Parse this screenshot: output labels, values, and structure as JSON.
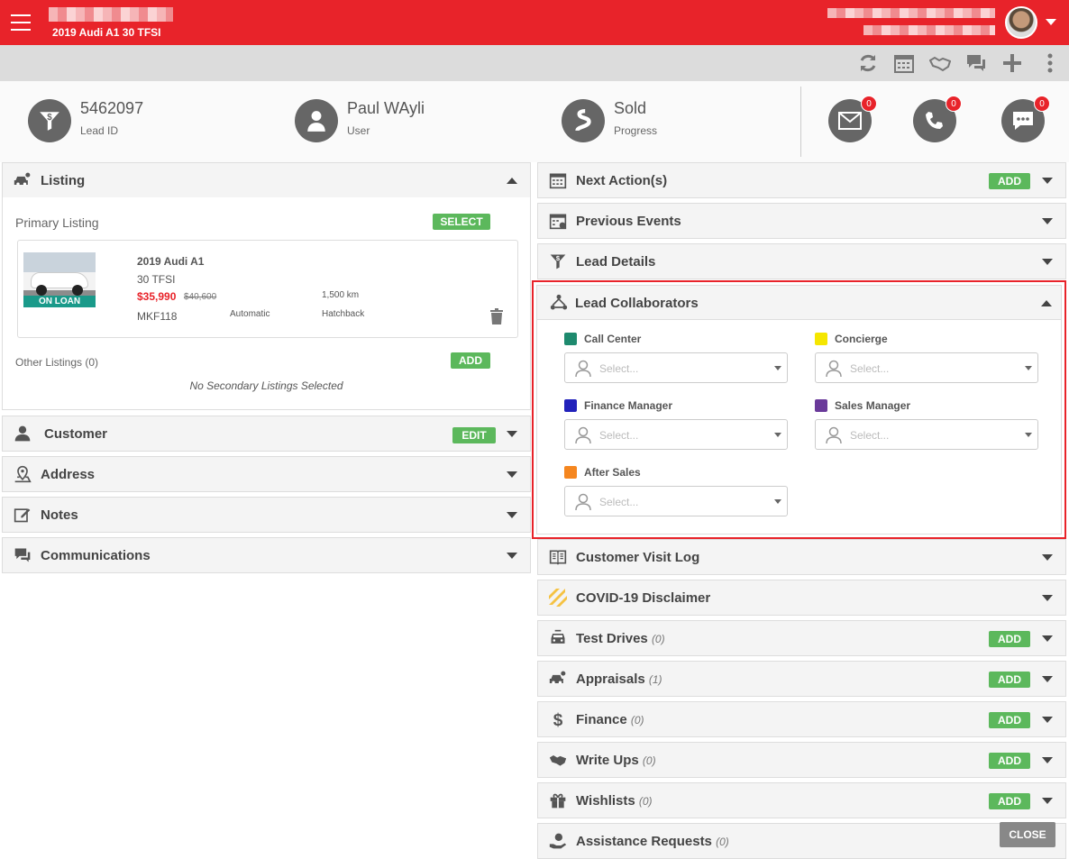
{
  "header": {
    "title": "2019 Audi A1 30 TFSI"
  },
  "stats": [
    {
      "value": "5462097",
      "label": "Lead ID"
    },
    {
      "value": "Paul WAyli",
      "label": "User"
    },
    {
      "value": "Sold",
      "label": "Progress"
    }
  ],
  "quick_actions": [
    {
      "icon": "envelope-icon",
      "count": "0"
    },
    {
      "icon": "phone-icon",
      "count": "0"
    },
    {
      "icon": "chat-icon",
      "count": "0"
    }
  ],
  "listing": {
    "title": "Listing",
    "primary_label": "Primary Listing",
    "select_label": "SELECT",
    "car": {
      "name": "2019 Audi A1",
      "variant": "30 TFSI",
      "price": "$35,990",
      "old_price": "$40,600",
      "km": "1,500 km",
      "rego": "MKF118",
      "transmission": "Automatic",
      "body": "Hatchback",
      "badge": "ON LOAN"
    },
    "other_label": "Other Listings (0)",
    "add_label": "ADD",
    "empty_text": "No Secondary Listings Selected"
  },
  "left_panels": [
    {
      "title": "Customer",
      "button": "EDIT"
    },
    {
      "title": "Address"
    },
    {
      "title": "Notes"
    },
    {
      "title": "Communications"
    }
  ],
  "right_top_panels": [
    {
      "title": "Next Action(s)",
      "button": "ADD"
    },
    {
      "title": "Previous Events"
    },
    {
      "title": "Lead Details"
    }
  ],
  "collaborators": {
    "title": "Lead Collaborators",
    "placeholder": "Select...",
    "roles": [
      {
        "label": "Call Center",
        "color": "#1e8a6e"
      },
      {
        "label": "Concierge",
        "color": "#f5e600"
      },
      {
        "label": "Finance Manager",
        "color": "#2222bb"
      },
      {
        "label": "Sales Manager",
        "color": "#6a3a9a"
      },
      {
        "label": "After Sales",
        "color": "#f5861f"
      }
    ]
  },
  "right_bottom_panels": [
    {
      "title": "Customer Visit Log",
      "count": ""
    },
    {
      "title": "COVID-19 Disclaimer",
      "count": ""
    },
    {
      "title": "Test Drives",
      "count": "(0)",
      "button": "ADD"
    },
    {
      "title": "Appraisals",
      "count": "(1)",
      "button": "ADD"
    },
    {
      "title": "Finance",
      "count": "(0)",
      "button": "ADD"
    },
    {
      "title": "Write Ups",
      "count": "(0)",
      "button": "ADD"
    },
    {
      "title": "Wishlists",
      "count": "(0)",
      "button": "ADD"
    },
    {
      "title": "Assistance Requests",
      "count": "(0)"
    }
  ],
  "close_label": "CLOSE",
  "colors": {
    "brand": "#e8232a",
    "success": "#5cb85c"
  }
}
